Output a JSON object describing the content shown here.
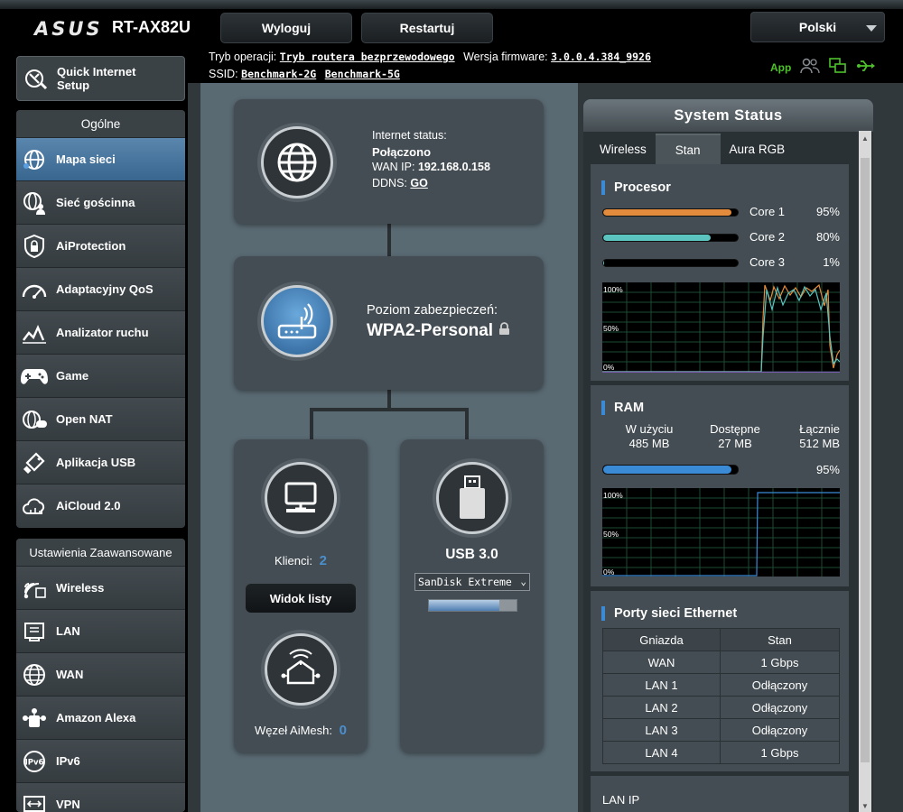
{
  "header": {
    "brand": "ASUS",
    "model": "RT-AX82U",
    "logout_label": "Wyloguj",
    "restart_label": "Restartuj",
    "language": "Polski"
  },
  "info": {
    "op_mode_label": "Tryb operacji:",
    "op_mode_value": "Tryb routera bezprzewodowego",
    "firmware_label": "Wersja firmware:",
    "firmware_value": "3.0.0.4.384_9926",
    "ssid_label": "SSID:",
    "ssid_2g": "Benchmark-2G",
    "ssid_5g": "Benchmark-5G",
    "app_label": "App"
  },
  "sidebar": {
    "quick_setup": "Quick Internet Setup",
    "general_header": "Ogólne",
    "general_items": [
      {
        "label": "Mapa sieci",
        "icon": "globe-network-icon"
      },
      {
        "label": "Sieć gościnna",
        "icon": "guest-network-icon"
      },
      {
        "label": "AiProtection",
        "icon": "shield-lock-icon"
      },
      {
        "label": "Adaptacyjny QoS",
        "icon": "gauge-icon"
      },
      {
        "label": "Analizator ruchu",
        "icon": "traffic-analyzer-icon"
      },
      {
        "label": "Game",
        "icon": "gamepad-icon"
      },
      {
        "label": "Open NAT",
        "icon": "open-nat-icon"
      },
      {
        "label": "Aplikacja USB",
        "icon": "usb-app-icon"
      },
      {
        "label": "AiCloud 2.0",
        "icon": "cloud-icon"
      }
    ],
    "advanced_header": "Ustawienia Zaawansowane",
    "advanced_items": [
      {
        "label": "Wireless",
        "icon": "wireless-icon"
      },
      {
        "label": "LAN",
        "icon": "lan-icon"
      },
      {
        "label": "WAN",
        "icon": "wan-globe-icon"
      },
      {
        "label": "Amazon Alexa",
        "icon": "alexa-icon"
      },
      {
        "label": "IPv6",
        "icon": "ipv6-icon"
      },
      {
        "label": "VPN",
        "icon": "vpn-icon"
      }
    ]
  },
  "network_map": {
    "internet_status_label": "Internet status:",
    "internet_status": "Połączono",
    "wan_ip_label": "WAN IP:",
    "wan_ip": "192.168.0.158",
    "ddns_label": "DDNS:",
    "ddns_value": "GO",
    "security_label": "Poziom zabezpieczeń:",
    "security_value": "WPA2-Personal",
    "clients_label": "Klienci:",
    "clients_count": "2",
    "list_view_label": "Widok listy",
    "aimesh_label": "Węzeł AiMesh:",
    "aimesh_count": "0",
    "usb_label": "USB 3.0",
    "usb_device": "SanDisk Extreme",
    "usb_fill": 0.8
  },
  "system_status": {
    "title": "System Status",
    "tabs": [
      "Wireless",
      "Stan",
      "Aura RGB"
    ],
    "active_tab": "Stan",
    "cpu": {
      "title": "Procesor",
      "cores": [
        {
          "name": "Core 1",
          "percent": "95%",
          "value": 0.95,
          "color": "#e38b3c"
        },
        {
          "name": "Core 2",
          "percent": "80%",
          "value": 0.8,
          "color": "#5bc4bf"
        },
        {
          "name": "Core 3",
          "percent": "1%",
          "value": 0.01,
          "color": "#5bc4bf"
        }
      ],
      "y_labels": [
        "100%",
        "50%",
        "0%"
      ]
    },
    "ram": {
      "title": "RAM",
      "used_label": "W użyciu",
      "used": "485 MB",
      "free_label": "Dostępne",
      "free": "27 MB",
      "total_label": "Łącznie",
      "total": "512 MB",
      "percent": "95%",
      "value": 0.95,
      "color": "#3a8ad6",
      "y_labels": [
        "100%",
        "50%",
        "0%"
      ]
    },
    "ethernet": {
      "title": "Porty sieci Ethernet",
      "headers": [
        "Gniazda",
        "Stan"
      ],
      "rows": [
        [
          "WAN",
          "1 Gbps"
        ],
        [
          "LAN 1",
          "Odłączony"
        ],
        [
          "LAN 2",
          "Odłączony"
        ],
        [
          "LAN 3",
          "Odłączony"
        ],
        [
          "LAN 4",
          "1 Gbps"
        ]
      ]
    },
    "lan_ip_label": "LAN IP"
  }
}
